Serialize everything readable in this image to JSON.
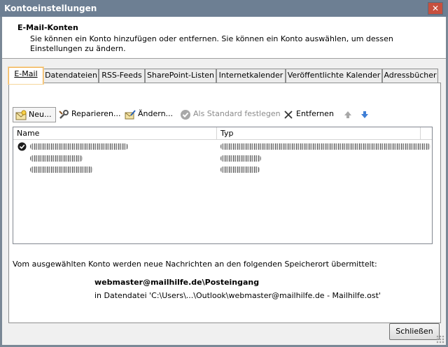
{
  "window": {
    "title": "Kontoeinstellungen",
    "close_glyph": "✕"
  },
  "header": {
    "title": "E-Mail-Konten",
    "description": "Sie können ein Konto hinzufügen oder entfernen. Sie können ein Konto auswählen, um dessen Einstellungen zu ändern."
  },
  "tabs": [
    {
      "label": "E-Mail",
      "active": true
    },
    {
      "label": "Datendateien"
    },
    {
      "label": "RSS-Feeds"
    },
    {
      "label": "SharePoint-Listen"
    },
    {
      "label": "Internetkalender"
    },
    {
      "label": "Veröffentlichte Kalender"
    },
    {
      "label": "Adressbücher"
    }
  ],
  "toolbar": {
    "new_label": "Neu...",
    "repair_label": "Reparieren...",
    "change_label": "Ändern...",
    "default_label": "Als Standard festlegen",
    "remove_label": "Entfernen",
    "up_icon": "arrow-up-icon",
    "down_icon": "arrow-down-icon"
  },
  "list": {
    "columns": [
      "Name",
      "Typ"
    ],
    "rows": [
      {
        "default": true,
        "name": "",
        "type": ""
      },
      {
        "default": false,
        "name": "",
        "type": ""
      },
      {
        "default": false,
        "name": "",
        "type": ""
      }
    ]
  },
  "info": {
    "text": "Vom ausgewählten Konto werden neue Nachrichten an den folgenden Speicherort übermittelt:",
    "store": "webmaster@mailhilfe.de\\Posteingang",
    "file": "in Datendatei 'C:\\Users\\...\\Outlook\\webmaster@mailhilfe.de - Mailhilfe.ost'"
  },
  "footer": {
    "close_label": "Schließen"
  },
  "colors": {
    "titlebar": "#6d7f93",
    "active_tab_highlight": "#f2b45a",
    "arrow_blue": "#3f7fd6"
  }
}
